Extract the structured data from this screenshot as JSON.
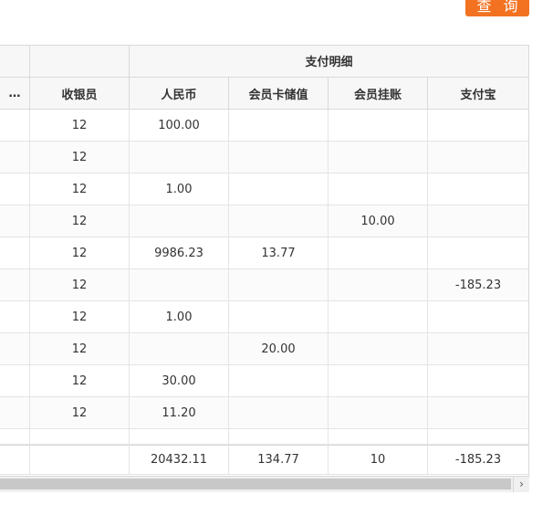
{
  "toolbar": {
    "query_label": "查 询"
  },
  "table": {
    "group_header": "支付明细",
    "columns": [
      "…",
      "收银员",
      "人民币",
      "会员卡储值",
      "会员挂账",
      "支付宝"
    ],
    "rows": [
      [
        "",
        "12",
        "100.00",
        "",
        "",
        ""
      ],
      [
        "",
        "12",
        "",
        "",
        "",
        ""
      ],
      [
        "",
        "12",
        "1.00",
        "",
        "",
        ""
      ],
      [
        "",
        "12",
        "",
        "",
        "10.00",
        ""
      ],
      [
        "",
        "12",
        "9986.23",
        "13.77",
        "",
        ""
      ],
      [
        "",
        "12",
        "",
        "",
        "",
        "-185.23"
      ],
      [
        "",
        "12",
        "1.00",
        "",
        "",
        ""
      ],
      [
        "",
        "12",
        "",
        "20.00",
        "",
        ""
      ],
      [
        "",
        "12",
        "30.00",
        "",
        "",
        ""
      ],
      [
        "",
        "12",
        "11.20",
        "",
        "",
        ""
      ]
    ],
    "totals": [
      "",
      "",
      "20432.11",
      "134.77",
      "10",
      "-185.23"
    ]
  },
  "icons": {
    "scroll_right": "chevron-right-icon"
  },
  "colors": {
    "accent": "#f27221"
  }
}
